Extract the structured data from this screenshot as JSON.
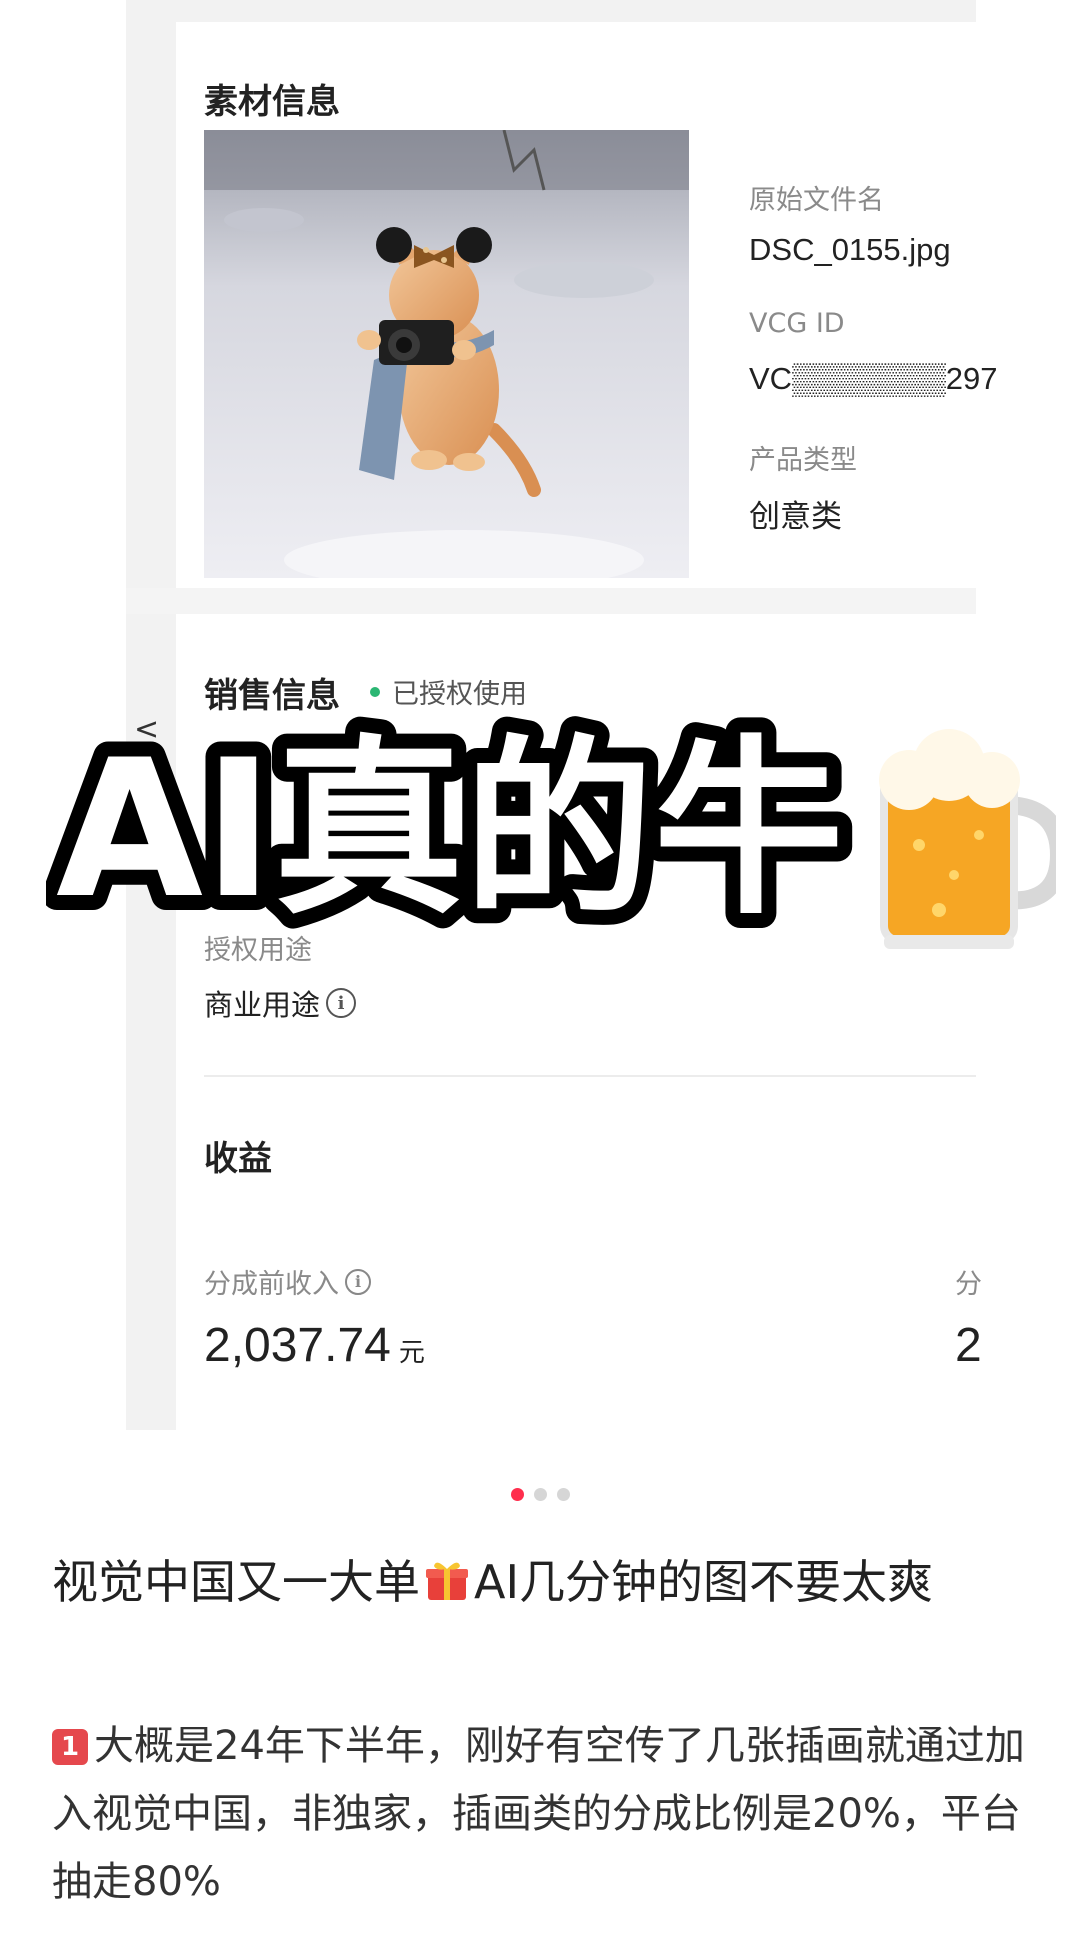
{
  "material": {
    "title": "素材信息",
    "fields": [
      {
        "label": "原始文件名",
        "value": "DSC_0155.jpg"
      },
      {
        "label": "VCG ID",
        "value": "VC▒▒▒▒▒▒▒297"
      },
      {
        "label": "产品类型",
        "value": "创意类"
      }
    ]
  },
  "sales": {
    "title": "销售信息",
    "status": "已授权使用",
    "auth_label": "授权用途",
    "auth_value": "商业用途",
    "back": "<"
  },
  "earnings": {
    "title": "收益",
    "label": "分成前收入",
    "amount": "2,037.74",
    "unit": "元",
    "next_label": "分",
    "next_value": "2"
  },
  "overlay": {
    "text": "AI真的牛"
  },
  "carousel": {
    "count": 3,
    "active_index": 0
  },
  "post": {
    "title_part1": "视觉中国又一大单",
    "title_part2": "AI几分钟的图不要太爽",
    "badge": "1",
    "body": "大概是24年下半年，刚好有空传了几张插画就通过加入视觉中国，非独家，插画类的分成比例是20%，平台抽走80%"
  },
  "colors": {
    "status_dot": "#2bb673",
    "carousel_active": "#ff2e4d",
    "badge": "#e5484d"
  }
}
